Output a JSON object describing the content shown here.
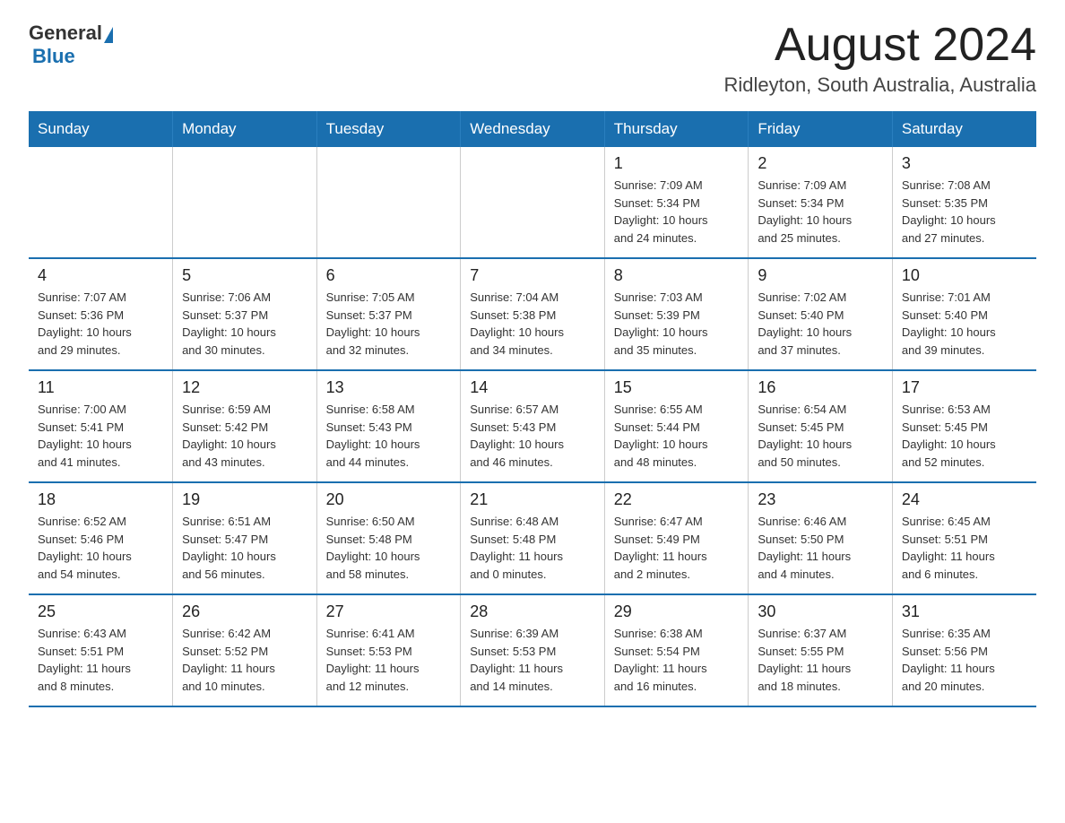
{
  "logo": {
    "text_general": "General",
    "text_blue": "Blue"
  },
  "header": {
    "month_year": "August 2024",
    "location": "Ridleyton, South Australia, Australia"
  },
  "days_of_week": [
    "Sunday",
    "Monday",
    "Tuesday",
    "Wednesday",
    "Thursday",
    "Friday",
    "Saturday"
  ],
  "weeks": [
    [
      {
        "day": "",
        "info": ""
      },
      {
        "day": "",
        "info": ""
      },
      {
        "day": "",
        "info": ""
      },
      {
        "day": "",
        "info": ""
      },
      {
        "day": "1",
        "info": "Sunrise: 7:09 AM\nSunset: 5:34 PM\nDaylight: 10 hours\nand 24 minutes."
      },
      {
        "day": "2",
        "info": "Sunrise: 7:09 AM\nSunset: 5:34 PM\nDaylight: 10 hours\nand 25 minutes."
      },
      {
        "day": "3",
        "info": "Sunrise: 7:08 AM\nSunset: 5:35 PM\nDaylight: 10 hours\nand 27 minutes."
      }
    ],
    [
      {
        "day": "4",
        "info": "Sunrise: 7:07 AM\nSunset: 5:36 PM\nDaylight: 10 hours\nand 29 minutes."
      },
      {
        "day": "5",
        "info": "Sunrise: 7:06 AM\nSunset: 5:37 PM\nDaylight: 10 hours\nand 30 minutes."
      },
      {
        "day": "6",
        "info": "Sunrise: 7:05 AM\nSunset: 5:37 PM\nDaylight: 10 hours\nand 32 minutes."
      },
      {
        "day": "7",
        "info": "Sunrise: 7:04 AM\nSunset: 5:38 PM\nDaylight: 10 hours\nand 34 minutes."
      },
      {
        "day": "8",
        "info": "Sunrise: 7:03 AM\nSunset: 5:39 PM\nDaylight: 10 hours\nand 35 minutes."
      },
      {
        "day": "9",
        "info": "Sunrise: 7:02 AM\nSunset: 5:40 PM\nDaylight: 10 hours\nand 37 minutes."
      },
      {
        "day": "10",
        "info": "Sunrise: 7:01 AM\nSunset: 5:40 PM\nDaylight: 10 hours\nand 39 minutes."
      }
    ],
    [
      {
        "day": "11",
        "info": "Sunrise: 7:00 AM\nSunset: 5:41 PM\nDaylight: 10 hours\nand 41 minutes."
      },
      {
        "day": "12",
        "info": "Sunrise: 6:59 AM\nSunset: 5:42 PM\nDaylight: 10 hours\nand 43 minutes."
      },
      {
        "day": "13",
        "info": "Sunrise: 6:58 AM\nSunset: 5:43 PM\nDaylight: 10 hours\nand 44 minutes."
      },
      {
        "day": "14",
        "info": "Sunrise: 6:57 AM\nSunset: 5:43 PM\nDaylight: 10 hours\nand 46 minutes."
      },
      {
        "day": "15",
        "info": "Sunrise: 6:55 AM\nSunset: 5:44 PM\nDaylight: 10 hours\nand 48 minutes."
      },
      {
        "day": "16",
        "info": "Sunrise: 6:54 AM\nSunset: 5:45 PM\nDaylight: 10 hours\nand 50 minutes."
      },
      {
        "day": "17",
        "info": "Sunrise: 6:53 AM\nSunset: 5:45 PM\nDaylight: 10 hours\nand 52 minutes."
      }
    ],
    [
      {
        "day": "18",
        "info": "Sunrise: 6:52 AM\nSunset: 5:46 PM\nDaylight: 10 hours\nand 54 minutes."
      },
      {
        "day": "19",
        "info": "Sunrise: 6:51 AM\nSunset: 5:47 PM\nDaylight: 10 hours\nand 56 minutes."
      },
      {
        "day": "20",
        "info": "Sunrise: 6:50 AM\nSunset: 5:48 PM\nDaylight: 10 hours\nand 58 minutes."
      },
      {
        "day": "21",
        "info": "Sunrise: 6:48 AM\nSunset: 5:48 PM\nDaylight: 11 hours\nand 0 minutes."
      },
      {
        "day": "22",
        "info": "Sunrise: 6:47 AM\nSunset: 5:49 PM\nDaylight: 11 hours\nand 2 minutes."
      },
      {
        "day": "23",
        "info": "Sunrise: 6:46 AM\nSunset: 5:50 PM\nDaylight: 11 hours\nand 4 minutes."
      },
      {
        "day": "24",
        "info": "Sunrise: 6:45 AM\nSunset: 5:51 PM\nDaylight: 11 hours\nand 6 minutes."
      }
    ],
    [
      {
        "day": "25",
        "info": "Sunrise: 6:43 AM\nSunset: 5:51 PM\nDaylight: 11 hours\nand 8 minutes."
      },
      {
        "day": "26",
        "info": "Sunrise: 6:42 AM\nSunset: 5:52 PM\nDaylight: 11 hours\nand 10 minutes."
      },
      {
        "day": "27",
        "info": "Sunrise: 6:41 AM\nSunset: 5:53 PM\nDaylight: 11 hours\nand 12 minutes."
      },
      {
        "day": "28",
        "info": "Sunrise: 6:39 AM\nSunset: 5:53 PM\nDaylight: 11 hours\nand 14 minutes."
      },
      {
        "day": "29",
        "info": "Sunrise: 6:38 AM\nSunset: 5:54 PM\nDaylight: 11 hours\nand 16 minutes."
      },
      {
        "day": "30",
        "info": "Sunrise: 6:37 AM\nSunset: 5:55 PM\nDaylight: 11 hours\nand 18 minutes."
      },
      {
        "day": "31",
        "info": "Sunrise: 6:35 AM\nSunset: 5:56 PM\nDaylight: 11 hours\nand 20 minutes."
      }
    ]
  ]
}
